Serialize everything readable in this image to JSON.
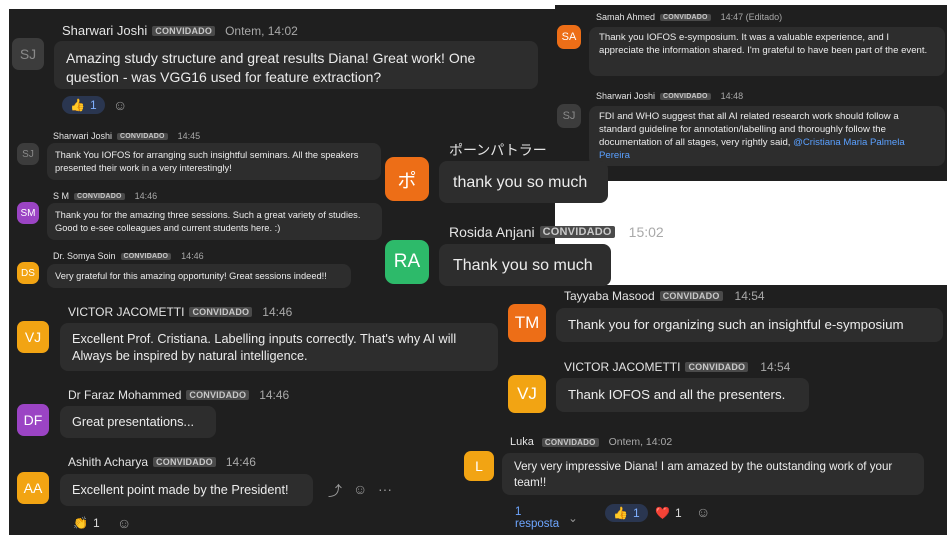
{
  "messages": [
    {
      "id": "m1",
      "avatar_text": "SJ",
      "avatar_color": "#3c3c3c",
      "avatar_text_color": "#8a8a8a",
      "name": "Sharwari Joshi",
      "badge": "CONVIDADO",
      "time": "Ontem, 14:02",
      "text": "Amazing study structure and great results Diana! Great work! One question - was VGG16 used for feature extraction?",
      "reaction_emoji": "👍",
      "reaction_count": "1"
    },
    {
      "id": "m2",
      "avatar_text": "SJ",
      "avatar_color": "#3c3c3c",
      "avatar_text_color": "#8a8a8a",
      "name": "Sharwari Joshi",
      "badge": "CONVIDADO",
      "time": "14:45",
      "text": "Thank You IOFOS for arranging such insightful seminars. All the speakers presented their work in a very interestingly!"
    },
    {
      "id": "m3",
      "avatar_text": "SM",
      "avatar_color": "#9b44c4",
      "name": "S M",
      "badge": "CONVIDADO",
      "time": "14:46",
      "text": "Thank you for the amazing three sessions. Such a great variety of studies. Good to e-see colleagues and current students here. :)"
    },
    {
      "id": "m4",
      "avatar_text": "DS",
      "avatar_color": "#f2a413",
      "name": "Dr. Somya Soin",
      "badge": "CONVIDADO",
      "time": "14:46",
      "text": "Very grateful for this amazing opportunity! Great sessions indeed!!"
    },
    {
      "id": "m5",
      "avatar_text": "VJ",
      "avatar_color": "#f2a413",
      "name": "VICTOR JACOMETTI",
      "badge": "CONVIDADO",
      "time": "14:46",
      "text": "Excellent Prof. Cristiana. Labelling inputs correctly. That's why AI will Always be inspired by natural intelligence."
    },
    {
      "id": "m6",
      "avatar_text": "DF",
      "avatar_color": "#9b44c4",
      "name": "Dr Faraz Mohammed",
      "badge": "CONVIDADO",
      "time": "14:46",
      "text": "Great presentations..."
    },
    {
      "id": "m7",
      "avatar_text": "AA",
      "avatar_color": "#f2a413",
      "name": "Ashith Acharya",
      "badge": "CONVIDADO",
      "time": "14:46",
      "text": "Excellent point made by the President!",
      "reaction_emoji": "👏",
      "reaction_count": "1"
    },
    {
      "id": "m8",
      "avatar_text": "SA",
      "avatar_color": "#ed6e17",
      "name": "Samah Ahmed",
      "badge": "CONVIDADO",
      "time": "14:47 (Editado)",
      "text": "Thank you  IOFOS e-symposium. It was a valuable experience, and I appreciate the information shared. I'm grateful to have been part of the event."
    },
    {
      "id": "m9",
      "avatar_text": "SJ",
      "avatar_color": "#3c3c3c",
      "avatar_text_color": "#8a8a8a",
      "name": "Sharwari Joshi",
      "badge": "CONVIDADO",
      "time": "14:48",
      "text": "FDI and WHO suggest that all AI related research work should follow a standard guideline for annotation/labelling and thoroughly follow the documentation of all stages, very rightly said, ",
      "mention": "@Cristiana Maria Palmela Pereira"
    },
    {
      "id": "m10",
      "avatar_text": "ポ",
      "avatar_color": "#ed6e17",
      "name": "ポーンパトラー",
      "text": "thank you so much"
    },
    {
      "id": "m11",
      "avatar_text": "RA",
      "avatar_color": "#2dba6a",
      "name": "Rosida Anjani",
      "badge": "CONVIDADO",
      "time": "15:02",
      "text": "Thank you so much"
    },
    {
      "id": "m12",
      "avatar_text": "TM",
      "avatar_color": "#ed6e17",
      "name": "Tayyaba Masood",
      "badge": "CONVIDADO",
      "time": "14:54",
      "text": "Thank you  for organizing such an insightful e-symposium"
    },
    {
      "id": "m13",
      "avatar_text": "VJ",
      "avatar_color": "#f2a413",
      "name": "VICTOR JACOMETTI",
      "badge": "CONVIDADO",
      "time": "14:54",
      "text": "Thank IOFOS and all the presenters."
    },
    {
      "id": "m14",
      "avatar_text": "L",
      "avatar_color": "#f2a413",
      "name": "Luka",
      "badge": "CONVIDADO",
      "time": "Ontem, 14:02",
      "text": "Very very impressive Diana! I am amazed by the outstanding work of your team!!",
      "replies_label": "1 resposta",
      "reaction_emoji": "👍",
      "reaction_count": "1",
      "reaction2_emoji": "❤️",
      "reaction2_count": "1"
    }
  ],
  "icons": {
    "reply": "⤴",
    "add_reaction": "☺",
    "more": "···",
    "chevron": "⌄"
  }
}
